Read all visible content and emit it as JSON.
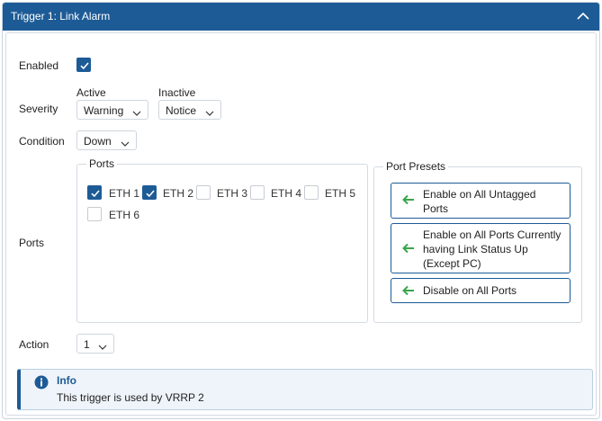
{
  "header": {
    "title": "Trigger 1: Link Alarm"
  },
  "enabled": {
    "label": "Enabled",
    "checked": true
  },
  "severity": {
    "label": "Severity",
    "active_label": "Active",
    "active_value": "Warning",
    "inactive_label": "Inactive",
    "inactive_value": "Notice"
  },
  "condition": {
    "label": "Condition",
    "value": "Down"
  },
  "ports": {
    "label": "Ports",
    "group_title": "Ports",
    "items": [
      {
        "label": "ETH 1",
        "checked": true
      },
      {
        "label": "ETH 2",
        "checked": true
      },
      {
        "label": "ETH 3",
        "checked": false
      },
      {
        "label": "ETH 4",
        "checked": false
      },
      {
        "label": "ETH 5",
        "checked": false
      },
      {
        "label": "ETH 6",
        "checked": false
      }
    ]
  },
  "presets": {
    "title": "Port Presets",
    "buttons": [
      {
        "line1": "Enable on All Untagged",
        "line2": "Ports"
      },
      {
        "line1": "Enable on All Ports Currently",
        "line2": "having Link Status Up",
        "line3": "(Except PC)"
      },
      {
        "line1": "Disable on All Ports"
      }
    ]
  },
  "action": {
    "label": "Action",
    "value": "1"
  },
  "info": {
    "title": "Info",
    "message": "This trigger is used by VRRP 2"
  },
  "colors": {
    "accent": "#1d5b96",
    "arrow": "#3aa64a",
    "info_bg": "#eef4fa"
  },
  "icons": {
    "collapse": "chevron-up-icon",
    "dropdown": "chevron-down-icon",
    "preset": "arrow-left-icon",
    "info": "info-icon"
  }
}
